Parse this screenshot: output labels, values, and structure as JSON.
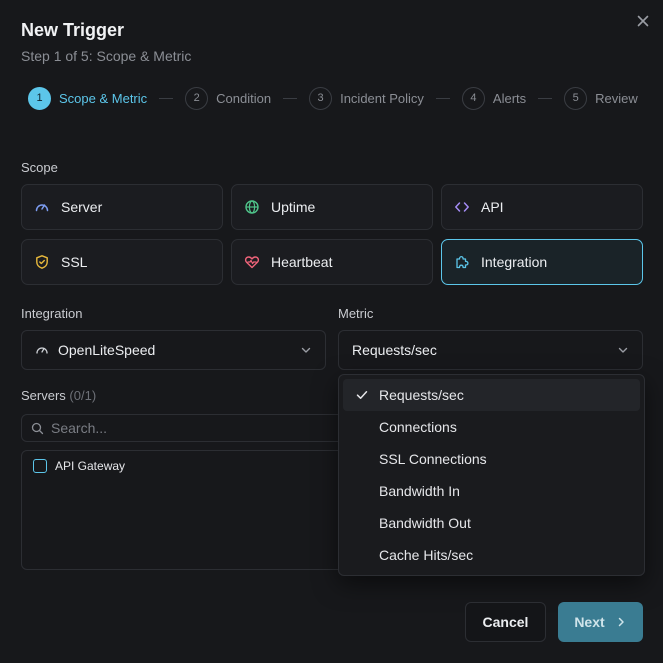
{
  "dialog": {
    "title": "New Trigger",
    "subtitle": "Step 1 of 5: Scope & Metric",
    "close_icon": "close-icon"
  },
  "stepper": [
    {
      "num": "1",
      "label": "Scope & Metric",
      "active": true
    },
    {
      "num": "2",
      "label": "Condition",
      "active": false
    },
    {
      "num": "3",
      "label": "Incident Policy",
      "active": false
    },
    {
      "num": "4",
      "label": "Alerts",
      "active": false
    },
    {
      "num": "5",
      "label": "Review",
      "active": false
    }
  ],
  "scope": {
    "label": "Scope",
    "options": [
      {
        "label": "Server",
        "icon": "gauge-icon",
        "selected": false
      },
      {
        "label": "Uptime",
        "icon": "globe-icon",
        "selected": false
      },
      {
        "label": "API",
        "icon": "code-icon",
        "selected": false
      },
      {
        "label": "SSL",
        "icon": "shield-icon",
        "selected": false
      },
      {
        "label": "Heartbeat",
        "icon": "heart-pulse-icon",
        "selected": false
      },
      {
        "label": "Integration",
        "icon": "puzzle-icon",
        "selected": true
      }
    ]
  },
  "integration": {
    "label": "Integration",
    "value": "OpenLiteSpeed",
    "icon": "gauge-icon"
  },
  "metric": {
    "label": "Metric",
    "value": "Requests/sec",
    "options": [
      "Requests/sec",
      "Connections",
      "SSL Connections",
      "Bandwidth In",
      "Bandwidth Out",
      "Cache Hits/sec"
    ],
    "selected_index": 0
  },
  "servers": {
    "label": "Servers",
    "count": "(0/1)",
    "search_placeholder": "Search...",
    "items": [
      "API Gateway"
    ]
  },
  "footer": {
    "cancel_label": "Cancel",
    "next_label": "Next"
  },
  "colors": {
    "accent": "#5cc6ea",
    "next_button": "#3a7c92",
    "background": "#17181b"
  }
}
